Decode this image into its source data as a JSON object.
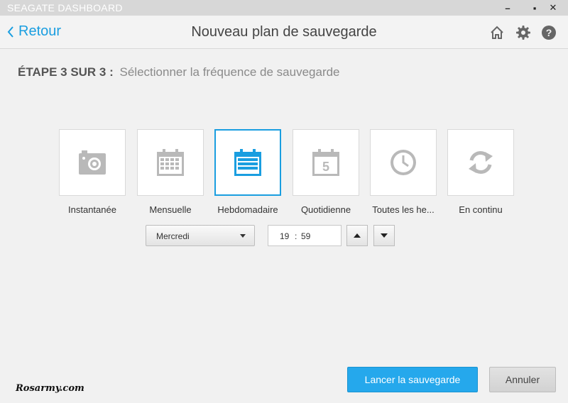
{
  "window": {
    "app_title": "SEAGATE DASHBOARD",
    "minimize": "–",
    "maximize": "▪",
    "close": "✕"
  },
  "header": {
    "back_label": "Retour",
    "title": "Nouveau plan de sauvegarde",
    "icons": [
      "home-icon",
      "gear-icon",
      "help-icon"
    ]
  },
  "step": {
    "number": "ÉTAPE  3 SUR 3 :",
    "description": "Sélectionner la fréquence de sauvegarde"
  },
  "frequency_options": [
    {
      "label": "Instantanée",
      "icon": "camera-icon",
      "selected": false
    },
    {
      "label": "Mensuelle",
      "icon": "monthly-calendar-icon",
      "selected": false
    },
    {
      "label": "Hebdomadaire",
      "icon": "weekly-calendar-icon",
      "selected": true
    },
    {
      "label": "Quotidienne",
      "icon": "daily-calendar-icon",
      "calendar_number": "5",
      "selected": false
    },
    {
      "label": "Toutes les he...",
      "icon": "clock-icon",
      "selected": false
    },
    {
      "label": "En continu",
      "icon": "sync-icon",
      "selected": false
    }
  ],
  "schedule": {
    "day_value": "Mercredi",
    "hour": "19",
    "separator": ":",
    "minute": "59"
  },
  "actions": {
    "start_label": "Lancer la sauvegarde",
    "cancel_label": "Annuler"
  },
  "watermark": "Rosarmy.com",
  "colors": {
    "accent": "#1a9ee0",
    "primary_button": "#25a8ec",
    "icon_gray": "#b9b9b9"
  }
}
